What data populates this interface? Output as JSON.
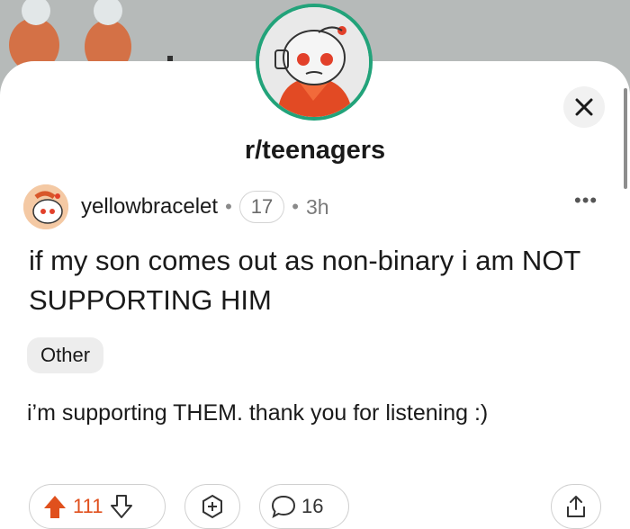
{
  "community": {
    "name": "r/teenagers"
  },
  "post": {
    "username": "yellowbracelet",
    "karma_badge": "17",
    "age": "3h",
    "title": "if my son comes out as non-binary i am NOT SUPPORTING HIM",
    "flair": "Other",
    "body": "i’m supporting THEM. thank you for listening :)"
  },
  "actions": {
    "upvotes": "111",
    "comments": "16"
  },
  "icons": {
    "close": "close-icon",
    "more": "more-options-icon",
    "upvote": "upvote-arrow-icon",
    "downvote": "downvote-arrow-icon",
    "award": "award-icon",
    "comment": "comment-bubble-icon",
    "share": "share-icon"
  },
  "colors": {
    "upvote": "#e0501d",
    "avatar_ring": "#22a37a"
  }
}
